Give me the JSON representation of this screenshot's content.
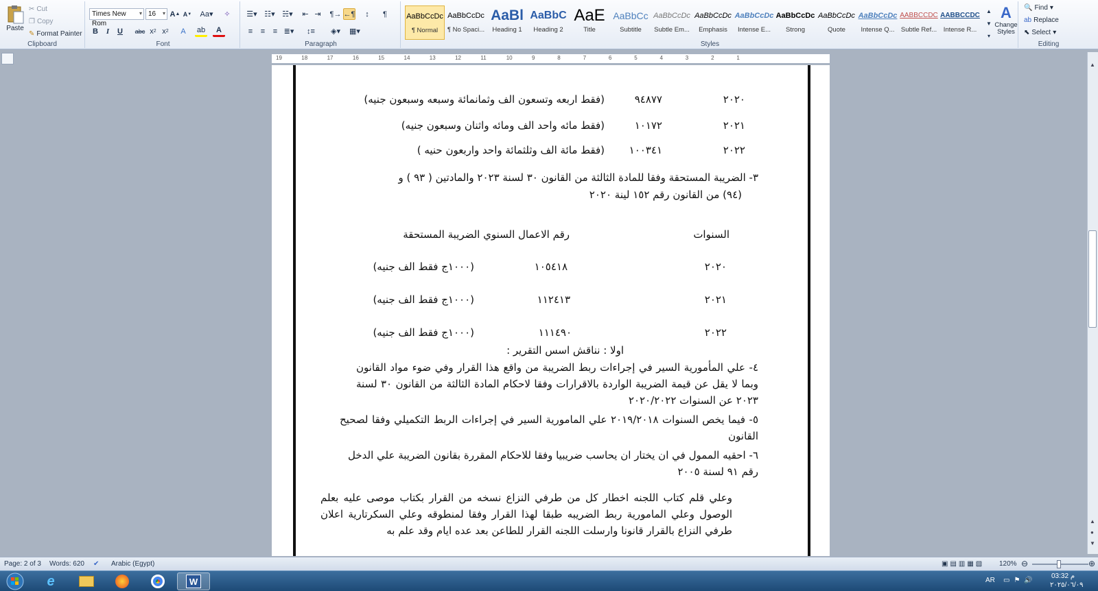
{
  "ribbon": {
    "clipboard": {
      "paste": "Paste",
      "cut": "Cut",
      "copy": "Copy",
      "format_painter": "Format Painter",
      "group_label": "Clipboard"
    },
    "font": {
      "font_name": "Times New Rom",
      "font_size": "16",
      "group_label": "Font"
    },
    "paragraph": {
      "group_label": "Paragraph"
    },
    "styles": {
      "group_label": "Styles",
      "items": [
        {
          "preview": "AaBbCcDc",
          "name": "¶ Normal"
        },
        {
          "preview": "AaBbCcDc",
          "name": "¶ No Spaci..."
        },
        {
          "preview": "AaBl",
          "name": "Heading 1"
        },
        {
          "preview": "AaBbC",
          "name": "Heading 2"
        },
        {
          "preview": "AaE",
          "name": "Title"
        },
        {
          "preview": "AaBbCc",
          "name": "Subtitle"
        },
        {
          "preview": "AaBbCcDc",
          "name": "Subtle Em..."
        },
        {
          "preview": "AaBbCcDc",
          "name": "Emphasis"
        },
        {
          "preview": "AaBbCcDc",
          "name": "Intense E..."
        },
        {
          "preview": "AaBbCcDc",
          "name": "Strong"
        },
        {
          "preview": "AaBbCcDc",
          "name": "Quote"
        },
        {
          "preview": "AaBbCcDc",
          "name": "Intense Q..."
        },
        {
          "preview": "AABBCCDC",
          "name": "Subtle Ref..."
        },
        {
          "preview": "AABBCCDC",
          "name": "Intense R..."
        }
      ],
      "change_styles": "Change Styles"
    },
    "editing": {
      "find": "Find",
      "replace": "Replace",
      "select": "Select",
      "group_label": "Editing"
    }
  },
  "ruler": {
    "ticks": [
      "19",
      "18",
      "17",
      "16",
      "15",
      "14",
      "13",
      "12",
      "11",
      "10",
      "9",
      "8",
      "7",
      "6",
      "5",
      "4",
      "3",
      "2",
      "1"
    ]
  },
  "document": {
    "table1": [
      {
        "year": "٢٠٢٠",
        "amount": "٩٤٨٧٧",
        "words": "(فقط اربعه وتسعون الف وثمانمائة وسبعه وسبعون جنيه)"
      },
      {
        "year": "٢٠٢١",
        "amount": "١٠١٧٢",
        "words": "(فقط مائه واحد الف ومائه واثنان وسبعون جنيه)"
      },
      {
        "year": "٢٠٢٢",
        "amount": "١٠٠٣٤١",
        "words": "(فقط مائة الف وثلثمائة واحد واربعون حنيه )"
      }
    ],
    "item3_line1": "٣- الضريبة المستحقة وفقا للمادة  الثالثة  من القانون ٣٠ لسنة ٢٠٢٣ والمادتين ( ٩٣ ) و",
    "item3_line2": "(٩٤) من القانون رقم ١٥٢ لينة ٢٠٢٠",
    "header_years": "السنوات",
    "header_turnover": "رقم الاعمال السنوي الضريبة المستحقة",
    "table2": [
      {
        "year": "٢٠٢٠",
        "amount": "١٠٥٤١٨",
        "tax": "(١٠٠٠ج فقط الف جنيه)"
      },
      {
        "year": "٢٠٢١",
        "amount": "١١٢٤١٣",
        "tax": "(١٠٠٠ج فقط الف جنيه)"
      },
      {
        "year": "٢٠٢٢",
        "amount": "١١١٤٩٠",
        "tax": "(١٠٠٠ج فقط الف جنيه)"
      }
    ],
    "first_heading": "اولا : نناقش اسس التقرير :",
    "item4": "٤- علي المأمورية السير في إجراءات ربط الضريبة من واقع هذا القرار وفي ضوء مواد القانون وبما لا يقل عن قيمة الضريبة الواردة بالاقرارات  وفقا لاحكام المادة الثالثة من القانون ٣٠ لسنة ٢٠٢٣ عن السنوات ٢٠٢٠/٢٠٢٢",
    "item5": "٥- فيما يخص السنوات ٢٠١٩/٢٠١٨ علي المامورية السير في إجراءات الربط التكميلي وفقا لصحيح القانون",
    "item6": "٦- احقيه الممول في ان يختار ان يحاسب ضريبيا وفقا للاحكام المقررة بقانون الضريبة علي الدخل رقم ٩١ لسنة ٢٠٠٥",
    "closing": "وعلي قلم كتاب اللجنه اخطار كل من طرفي النزاع نسخه من القرار بكتاب موصى عليه بعلم الوصول وعلي المامورية ربط الضريبه طبقا لهذا القرار وفقا لمنطوقه وعلي السكرتارية اعلان طرفي النزاع بالقرار قانونا وارسلت اللجنه القرار للطاعن بعد عده ايام وقد علم به"
  },
  "status": {
    "page": "Page: 2 of 3",
    "words": "Words: 620",
    "language": "Arabic (Egypt)",
    "zoom": "120%"
  },
  "taskbar": {
    "lang": "AR",
    "time": "03:32 م",
    "date": "٢٠٢٥/٠٦/٠٩"
  },
  "colors": {
    "ribbon_bg": "#e6ecf5",
    "selected_style": "#fde9a8",
    "taskbar": "#2a5a8a"
  }
}
